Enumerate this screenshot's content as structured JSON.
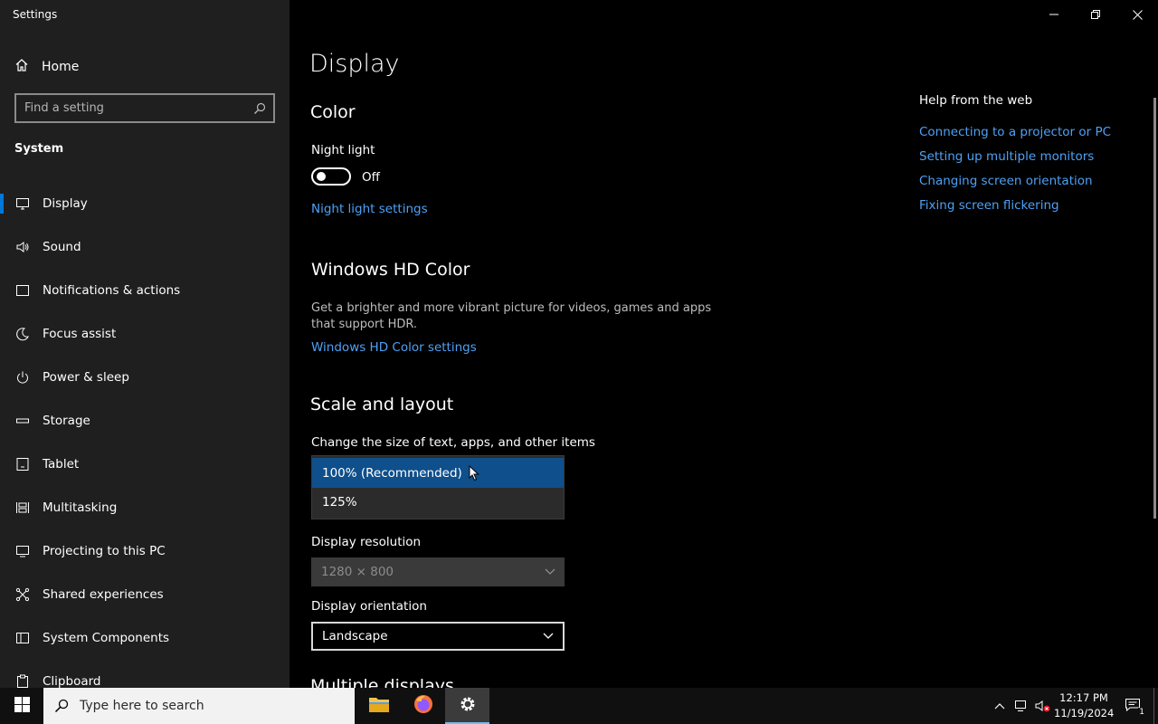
{
  "window": {
    "title": "Settings"
  },
  "sidebar": {
    "home_label": "Home",
    "search_placeholder": "Find a setting",
    "section": "System",
    "items": [
      {
        "label": "Display",
        "icon": "monitor-icon",
        "active": true
      },
      {
        "label": "Sound",
        "icon": "speaker-icon"
      },
      {
        "label": "Notifications & actions",
        "icon": "message-icon"
      },
      {
        "label": "Focus assist",
        "icon": "moon-icon"
      },
      {
        "label": "Power & sleep",
        "icon": "power-icon"
      },
      {
        "label": "Storage",
        "icon": "storage-icon"
      },
      {
        "label": "Tablet",
        "icon": "tablet-icon"
      },
      {
        "label": "Multitasking",
        "icon": "multitasking-icon"
      },
      {
        "label": "Projecting to this PC",
        "icon": "projector-icon"
      },
      {
        "label": "Shared experiences",
        "icon": "shared-icon"
      },
      {
        "label": "System Components",
        "icon": "components-icon"
      },
      {
        "label": "Clipboard",
        "icon": "clipboard-icon"
      }
    ]
  },
  "main": {
    "title": "Display",
    "color": {
      "heading": "Color",
      "night_light_label": "Night light",
      "night_light_state": "Off",
      "night_light_link": "Night light settings"
    },
    "hdr": {
      "heading": "Windows HD Color",
      "description": "Get a brighter and more vibrant picture for videos, games and apps that support HDR.",
      "link": "Windows HD Color settings"
    },
    "scale": {
      "heading": "Scale and layout",
      "size_label": "Change the size of text, apps, and other items",
      "options": [
        "100% (Recommended)",
        "125%"
      ],
      "selected": "100% (Recommended)",
      "resolution_label": "Display resolution",
      "resolution_value": "1280 × 800",
      "orientation_label": "Display orientation",
      "orientation_value": "Landscape",
      "next_heading_partial": "Multiple displays"
    },
    "help": {
      "title": "Help from the web",
      "links": [
        "Connecting to a projector or PC",
        "Setting up multiple monitors",
        "Changing screen orientation",
        "Fixing screen flickering"
      ]
    }
  },
  "taskbar": {
    "search_placeholder": "Type here to search",
    "apps": [
      "file-explorer-icon",
      "firefox-icon",
      "settings-icon"
    ],
    "time": "12:17 PM",
    "date": "11/19/2024",
    "notification_count": "1"
  },
  "colors": {
    "accent": "#0078d7",
    "link": "#4ea1f5",
    "selected_option": "#0f4f8b"
  }
}
